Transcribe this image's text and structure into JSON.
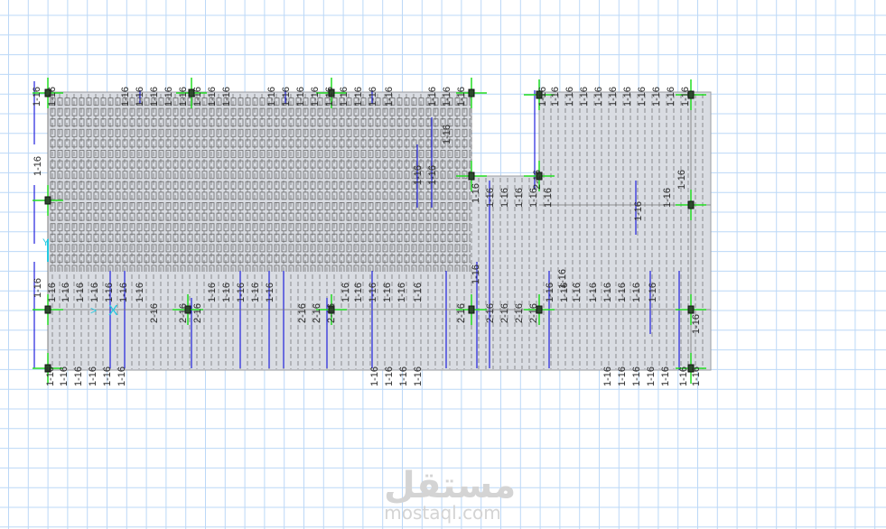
{
  "drawing": {
    "title": "Slab strip plan",
    "colors": {
      "grid": "#bcd8f7",
      "slab": "#d9dce2",
      "column_cross": "#22dd22",
      "strip_line": "#2222dd",
      "axis": "#22c8e0",
      "dash": "#555555"
    },
    "axis_labels": {
      "y": "Y",
      "x": "X"
    },
    "top_labels": [
      "1-16",
      "1-16",
      "1-16",
      "1-16",
      "1-16",
      "1-16",
      "1-16",
      "1-16",
      "1-16",
      "1-16",
      "1-16",
      "1-16",
      "1-16",
      "1-16",
      "1-16",
      "1-16",
      "1-16",
      "1-16",
      "1-16",
      "1-16",
      "1-16",
      "1-16",
      "1-16",
      "1-16",
      "1-16",
      "1-16",
      "1-16",
      "1-16",
      "1-16",
      "1-16",
      "1-16",
      "1-16",
      "1-16"
    ],
    "left_labels": [
      "1-16",
      "1-16"
    ],
    "mid_labels": [
      "1-16",
      "1-16",
      "1-16",
      "1-16",
      "1-16",
      "1-16",
      "1-16",
      "2-16",
      "2-16",
      "2-16",
      "1-16",
      "1-16",
      "1-16",
      "1-16",
      "1-16",
      "2-16",
      "2-16",
      "2-16",
      "1-16",
      "1-16",
      "1-16",
      "1-16",
      "1-16",
      "1-16",
      "2-16",
      "1-16",
      "2-16",
      "2-16",
      "2-16",
      "2-16",
      "1-16",
      "1-16",
      "1-16",
      "1-16",
      "1-16",
      "1-16",
      "1-16",
      "1-16"
    ],
    "upper_labels": [
      "1-16",
      "1-16",
      "1-16",
      "1-16",
      "1-16",
      "1-16",
      "1-16",
      "1-16",
      "1-16",
      "1-16",
      "2-16",
      "1-16",
      "1-16",
      "1-16",
      "1-16"
    ],
    "bottom_labels": [
      "1-16",
      "1-16",
      "1-16",
      "1-16",
      "1-16",
      "1-16",
      "1-16",
      "1-16",
      "1-16",
      "1-16",
      "1-16",
      "1-16",
      "1-16",
      "1-16",
      "1-16",
      "1-16",
      "1-16"
    ]
  },
  "watermark": {
    "arabic": "مستقل",
    "latin": "mostaql.com"
  }
}
